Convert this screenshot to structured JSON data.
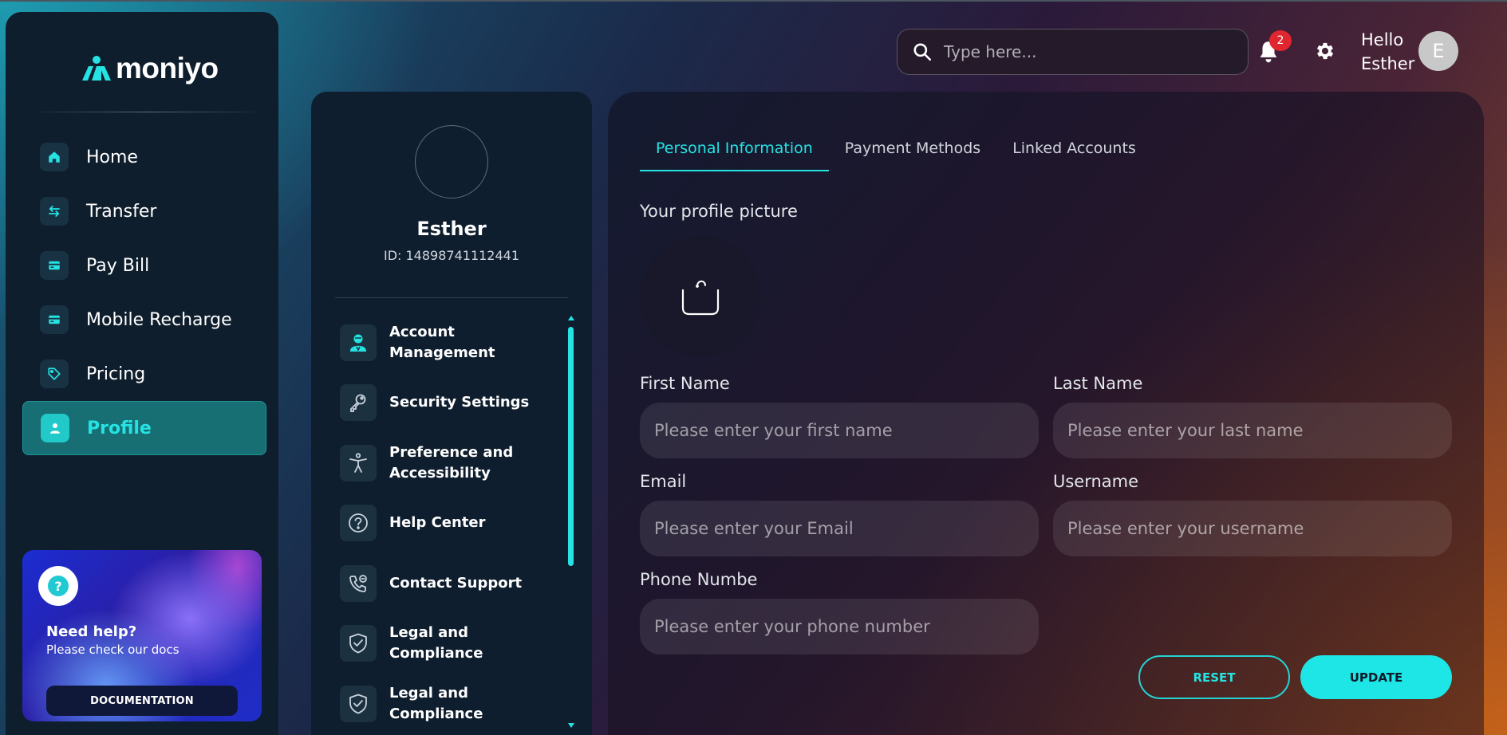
{
  "brand": {
    "name": "moniyo",
    "accent": "#25e3e3"
  },
  "sidebar": {
    "items": [
      {
        "label": "Home",
        "icon": "home-icon"
      },
      {
        "label": "Transfer",
        "icon": "transfer-icon"
      },
      {
        "label": "Pay Bill",
        "icon": "card-icon"
      },
      {
        "label": "Mobile Recharge",
        "icon": "card-icon"
      },
      {
        "label": "Pricing",
        "icon": "tag-icon"
      },
      {
        "label": "Profile",
        "icon": "user-icon",
        "active": true
      }
    ],
    "help": {
      "title": "Need help?",
      "subtitle": "Please check our docs",
      "button": "DOCUMENTATION",
      "icon_glyph": "?"
    }
  },
  "topbar": {
    "search_placeholder": "Type here...",
    "notifications_count": "2",
    "greeting_line1": "Hello",
    "greeting_line2": "Esther",
    "avatar_initial": "E"
  },
  "profile": {
    "name": "Esther",
    "id": "ID: 14898741112441",
    "menu": [
      {
        "label": "Account Management",
        "icon": "account-manager-icon"
      },
      {
        "label": "Security Settings",
        "icon": "key-icon"
      },
      {
        "label": "Preference and Accessibility",
        "icon": "accessibility-icon"
      },
      {
        "label": "Help Center",
        "icon": "question-icon"
      },
      {
        "label": "Contact Support",
        "icon": "phone-support-icon"
      },
      {
        "label": "Legal and Compliance",
        "icon": "shield-check-icon"
      },
      {
        "label": "Legal and Compliance",
        "icon": "shield-check-icon"
      }
    ]
  },
  "form": {
    "tabs": [
      "Personal Information",
      "Payment Methods",
      "Linked Accounts"
    ],
    "active_tab": "Personal Information",
    "profile_picture_label": "Your profile picture",
    "first_name": {
      "label": "First Name",
      "placeholder": "Please enter your first name",
      "value": ""
    },
    "last_name": {
      "label": "Last Name",
      "placeholder": "Please enter your last name",
      "value": ""
    },
    "email": {
      "label": "Email",
      "placeholder": "Please enter your Email",
      "value": ""
    },
    "username": {
      "label": "Username",
      "placeholder": "Please enter your username",
      "value": ""
    },
    "phone": {
      "label": "Phone Numbe",
      "placeholder": "Please enter your phone number",
      "value": ""
    },
    "reset_label": "RESET",
    "update_label": "UPDATE"
  }
}
